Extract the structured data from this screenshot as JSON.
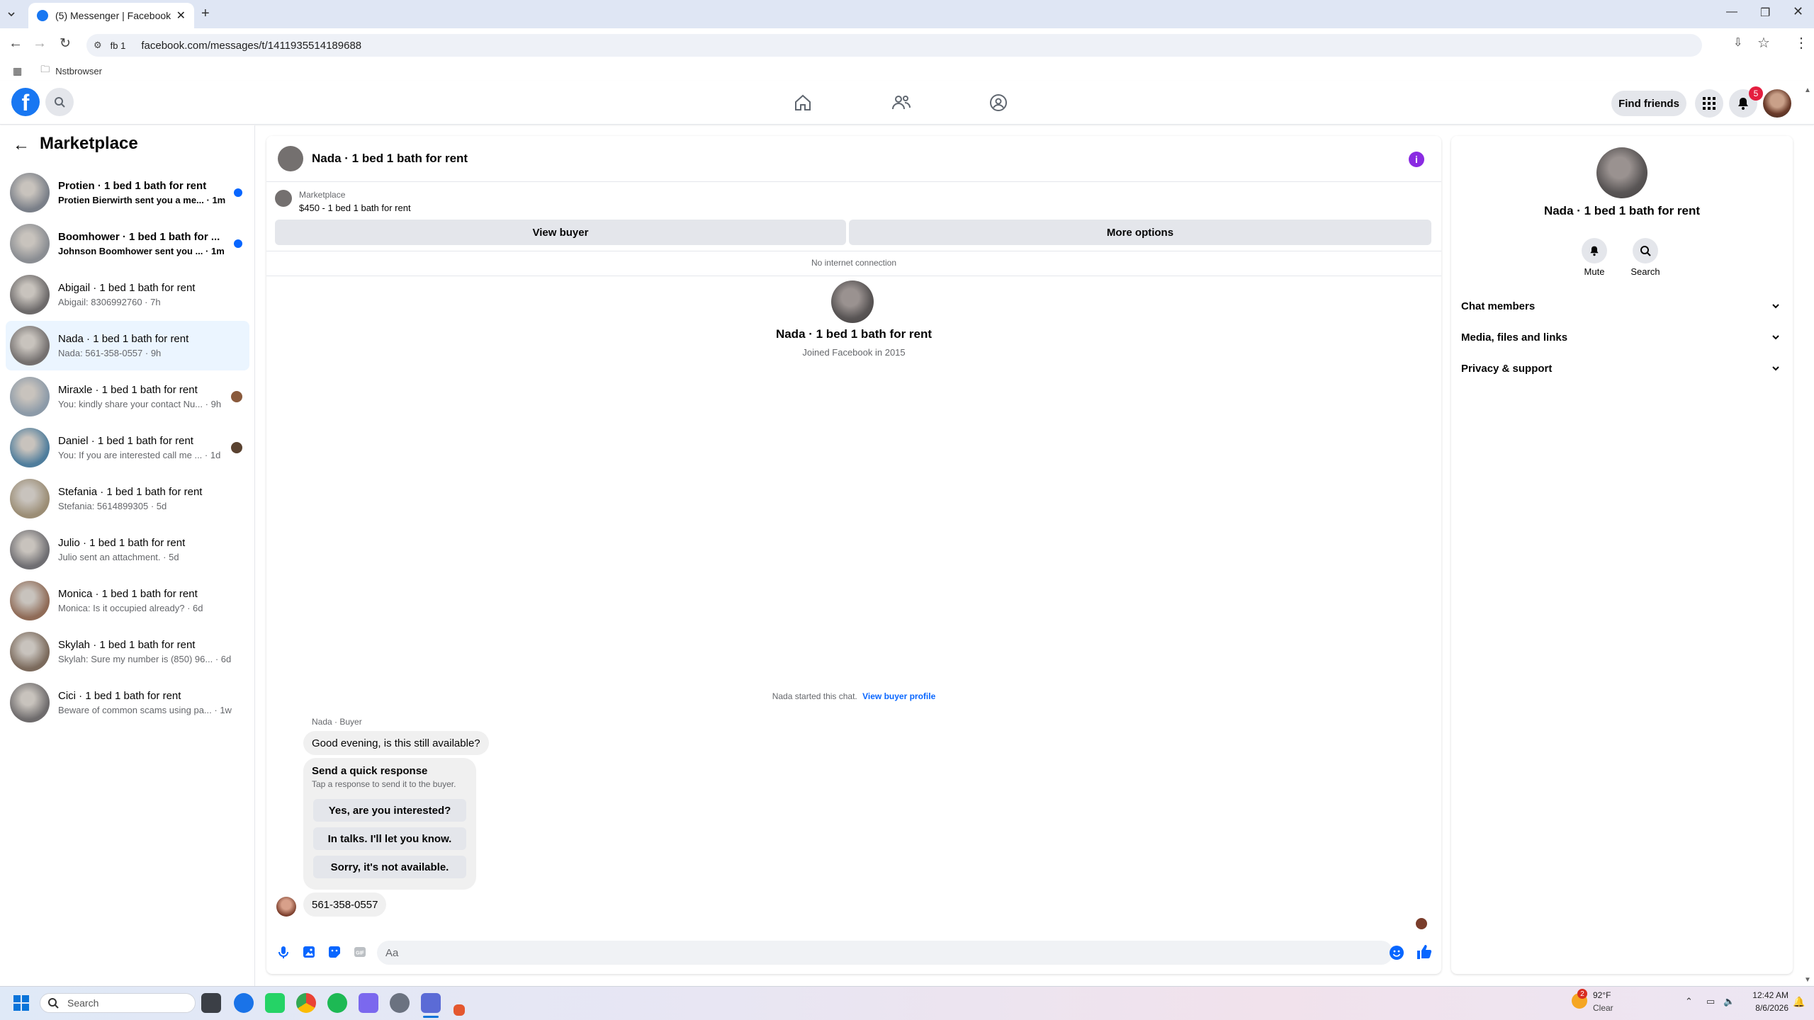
{
  "browser": {
    "tab_title": "(5) Messenger | Facebook",
    "profile_chip": "fb 1",
    "url": "facebook.com/messages/t/1411935514189688",
    "bookmark_folder": "Nstbrowser"
  },
  "header": {
    "find_friends": "Find friends",
    "notif_count": "5",
    "brand_color": "#1877f2"
  },
  "sidebar": {
    "title": "Marketplace",
    "items": [
      {
        "name": "Protien · 1 bed 1 bath for rent",
        "snippet": "Protien Bierwirth sent you a me...",
        "time": "1m",
        "unread": true,
        "avatar": "#7a7f88"
      },
      {
        "name": "Boomhower · 1 bed 1 bath for ...",
        "snippet": "Johnson Boomhower sent you ...",
        "time": "1m",
        "unread": true,
        "avatar": "#8a8d92"
      },
      {
        "name": "Abigail · 1 bed 1 bath for rent",
        "snippet": "Abigail: 8306992760",
        "time": "7h",
        "unread": false,
        "avatar": "#6d6a6a"
      },
      {
        "name": "Nada · 1 bed 1 bath for rent",
        "snippet": "Nada: 561-358-0557",
        "time": "9h",
        "unread": false,
        "avatar": "#74706f"
      },
      {
        "name": "Miraxle · 1 bed 1 bath for rent",
        "snippet": "You: kindly share your contact Nu...",
        "time": "9h",
        "unread": false,
        "avatar": "#8c9aa8"
      },
      {
        "name": "Daniel · 1 bed 1 bath for rent",
        "snippet": "You: If you are interested call me ...",
        "time": "1d",
        "unread": false,
        "avatar": "#4f7d9c"
      },
      {
        "name": "Stefania · 1 bed 1 bath for rent",
        "snippet": "Stefania: 5614899305",
        "time": "5d",
        "unread": false,
        "avatar": "#9b8d75"
      },
      {
        "name": "Julio · 1 bed 1 bath for rent",
        "snippet": "Julio sent an attachment.",
        "time": "5d",
        "unread": false,
        "avatar": "#6f6e72"
      },
      {
        "name": "Monica · 1 bed 1 bath for rent",
        "snippet": "Monica: Is it occupied already?",
        "time": "6d",
        "unread": false,
        "avatar": "#8f6b57"
      },
      {
        "name": "Skylah · 1 bed 1 bath for rent",
        "snippet": "Skylah: Sure my number is (850) 96...",
        "time": "6d",
        "unread": false,
        "avatar": "#7b6a5c"
      },
      {
        "name": "Cici · 1 bed 1 bath for rent",
        "snippet": "Beware of common scams using pa...",
        "time": "1w",
        "unread": false,
        "avatar": "#6e6b6c"
      }
    ]
  },
  "chat": {
    "title": "Nada · 1 bed 1 bath for rent",
    "listing_label": "Marketplace",
    "listing_detail": "$450 - 1 bed 1 bath for rent",
    "view_buyer": "View buyer",
    "more_options": "More options",
    "offline_notice": "No internet connection",
    "profile_name": "Nada · 1 bed 1 bath for rent",
    "joined": "Joined Facebook in 2015",
    "started_text": "Nada started this chat.",
    "view_profile": "View buyer profile",
    "sender_label": "Nada · Buyer",
    "first_message": "Good evening, is this still available?",
    "quick_title": "Send a quick response",
    "quick_sub": "Tap a response to send it to the buyer.",
    "quick_replies": [
      "Yes, are you interested?",
      "In talks. I'll let you know.",
      "Sorry, it's not available."
    ],
    "second_message": "561-358-0557",
    "composer_placeholder": "Aa"
  },
  "info_panel": {
    "name": "Nada · 1 bed 1 bath for rent",
    "mute": "Mute",
    "search": "Search",
    "sections": [
      "Chat members",
      "Media, files and links",
      "Privacy & support"
    ]
  },
  "taskbar": {
    "search": "Search",
    "weather_temp": "92°F",
    "weather_desc": "Clear",
    "weather_badge": "2",
    "time": "12:42 AM",
    "date": "8/6/2026"
  }
}
